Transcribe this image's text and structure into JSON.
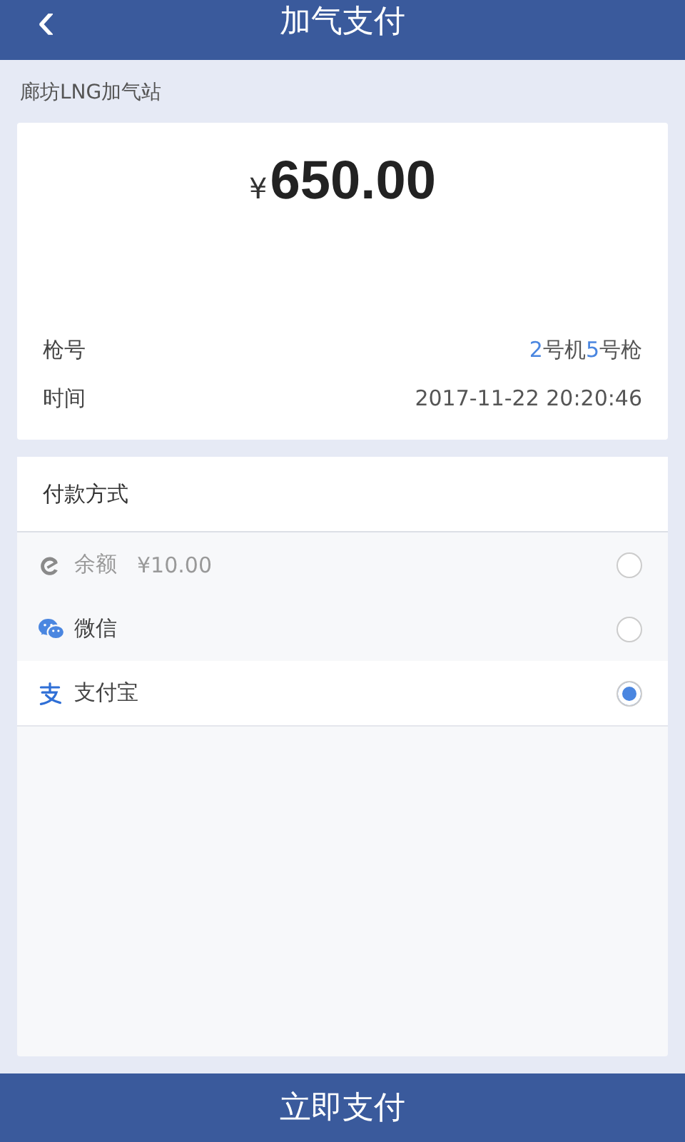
{
  "header": {
    "back": "‹",
    "title": "加气支付"
  },
  "station": "廊坊LNG加气站",
  "order": {
    "currency": "¥",
    "amount": "650.00",
    "rows": [
      {
        "label": "枪号",
        "parts": [
          {
            "text": "2",
            "highlight": true
          },
          {
            "text": "号机",
            "highlight": false
          },
          {
            "text": "5",
            "highlight": true
          },
          {
            "text": "号枪",
            "highlight": false
          }
        ]
      },
      {
        "label": "时间",
        "parts": [
          {
            "text": "2017-11-22 20:20:46",
            "highlight": false
          }
        ]
      }
    ]
  },
  "payment": {
    "title": "付款方式",
    "methods": [
      {
        "kind": "balance",
        "label": "余额",
        "extra": "¥10.00",
        "disabled": true,
        "selected": false
      },
      {
        "kind": "wechat",
        "label": "微信",
        "disabled": false,
        "selected": false
      },
      {
        "kind": "alipay",
        "label": "支付宝",
        "disabled": false,
        "selected": true
      }
    ]
  },
  "submit": "立即支付"
}
